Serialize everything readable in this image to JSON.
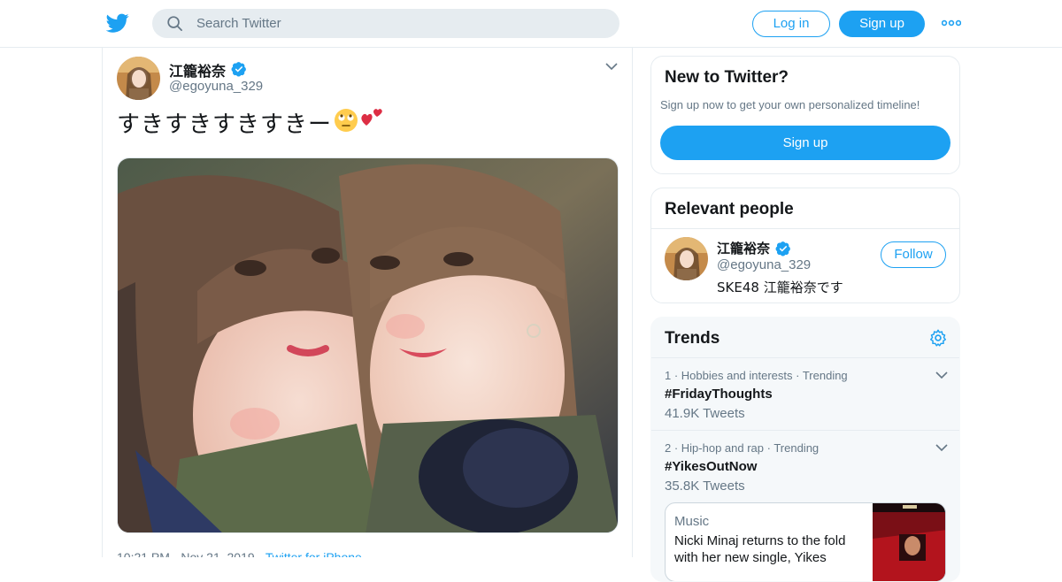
{
  "header": {
    "search_placeholder": "Search Twitter",
    "login_label": "Log in",
    "signup_label": "Sign up",
    "brand_color": "#1da1f2"
  },
  "tweet": {
    "author_name": "江籠裕奈",
    "author_handle": "@egoyuna_329",
    "text": "すきすきすきすきー",
    "emojis": [
      "rolling-eyes-emoji",
      "two-hearts-emoji"
    ],
    "meta": "10:21 PM - Nov 21, 2019",
    "source": "Twitter for iPhone"
  },
  "sidebar": {
    "new_card": {
      "title": "New to Twitter?",
      "subtitle": "Sign up now to get your own personalized timeline!",
      "button": "Sign up"
    },
    "relevant": {
      "title": "Relevant people",
      "name": "江籠裕奈",
      "handle": "@egoyuna_329",
      "bio": "SKE48 江籠裕奈です",
      "follow_label": "Follow"
    },
    "trends": {
      "title": "Trends",
      "items": [
        {
          "context": "1 · Hobbies and interests · Trending",
          "tag": "#FridayThoughts",
          "count": "41.9K Tweets"
        },
        {
          "context": "2 · Hip-hop and rap · Trending",
          "tag": "#YikesOutNow",
          "count": "35.8K Tweets"
        }
      ],
      "news": {
        "category": "Music",
        "headline": "Nicki Minaj returns to the fold with her new single, Yikes"
      }
    }
  }
}
